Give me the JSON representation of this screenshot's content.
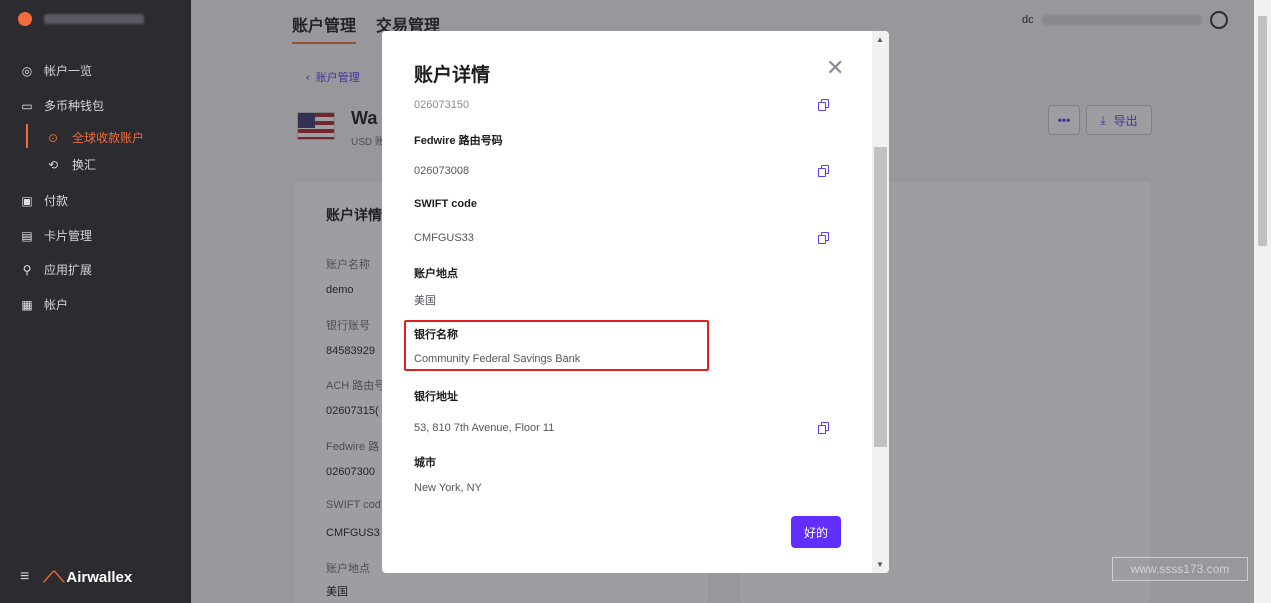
{
  "sidebar": {
    "items": [
      {
        "label": "帐户一览",
        "icon": "dashboard-icon"
      },
      {
        "label": "多币种钱包",
        "icon": "wallet-icon"
      },
      {
        "label": "全球收款账户",
        "icon": "globe-icon"
      },
      {
        "label": "换汇",
        "icon": "exchange-icon"
      },
      {
        "label": "付款",
        "icon": "payment-icon"
      },
      {
        "label": "卡片管理",
        "icon": "card-icon"
      },
      {
        "label": "应用扩展",
        "icon": "link-icon"
      },
      {
        "label": "帐户",
        "icon": "account-icon"
      }
    ],
    "brand": "Airwallex",
    "accent_color": "#f26b3a"
  },
  "header": {
    "tabs": [
      "账户管理",
      "交易管理"
    ],
    "user_prefix": "dc"
  },
  "page": {
    "back_label": "账户管理",
    "account_title": "Wa",
    "account_sub": "USD 账",
    "export_label": "导出",
    "more_label": "•••",
    "card_heading": "账户详情",
    "fields": [
      {
        "label": "账户名称",
        "value": "demo"
      },
      {
        "label": "银行账号",
        "value": "84583929"
      },
      {
        "label": "ACH 路由号",
        "value": "02607315("
      },
      {
        "label": "Fedwire 路",
        "value": "02607300"
      },
      {
        "label": "SWIFT cod",
        "value": "CMFGUS3"
      },
      {
        "label": "账户地点",
        "value": "美国"
      }
    ]
  },
  "modal": {
    "title": "账户详情",
    "first_value": "026073150",
    "fields": [
      {
        "label": "Fedwire 路由号码",
        "value": "026073008"
      },
      {
        "label": "SWIFT code",
        "value": "CMFGUS33"
      },
      {
        "label": "账户地点",
        "value": "美国"
      },
      {
        "label": "银行名称",
        "value": "Community Federal Savings Bank"
      },
      {
        "label": "银行地址",
        "value": "53, 810 7th Avenue, Floor 11"
      },
      {
        "label": "城市",
        "value": "New York, NY"
      }
    ],
    "ok_label": "好的",
    "button_color": "#612fff"
  },
  "watermark": "www.ssss173.com"
}
